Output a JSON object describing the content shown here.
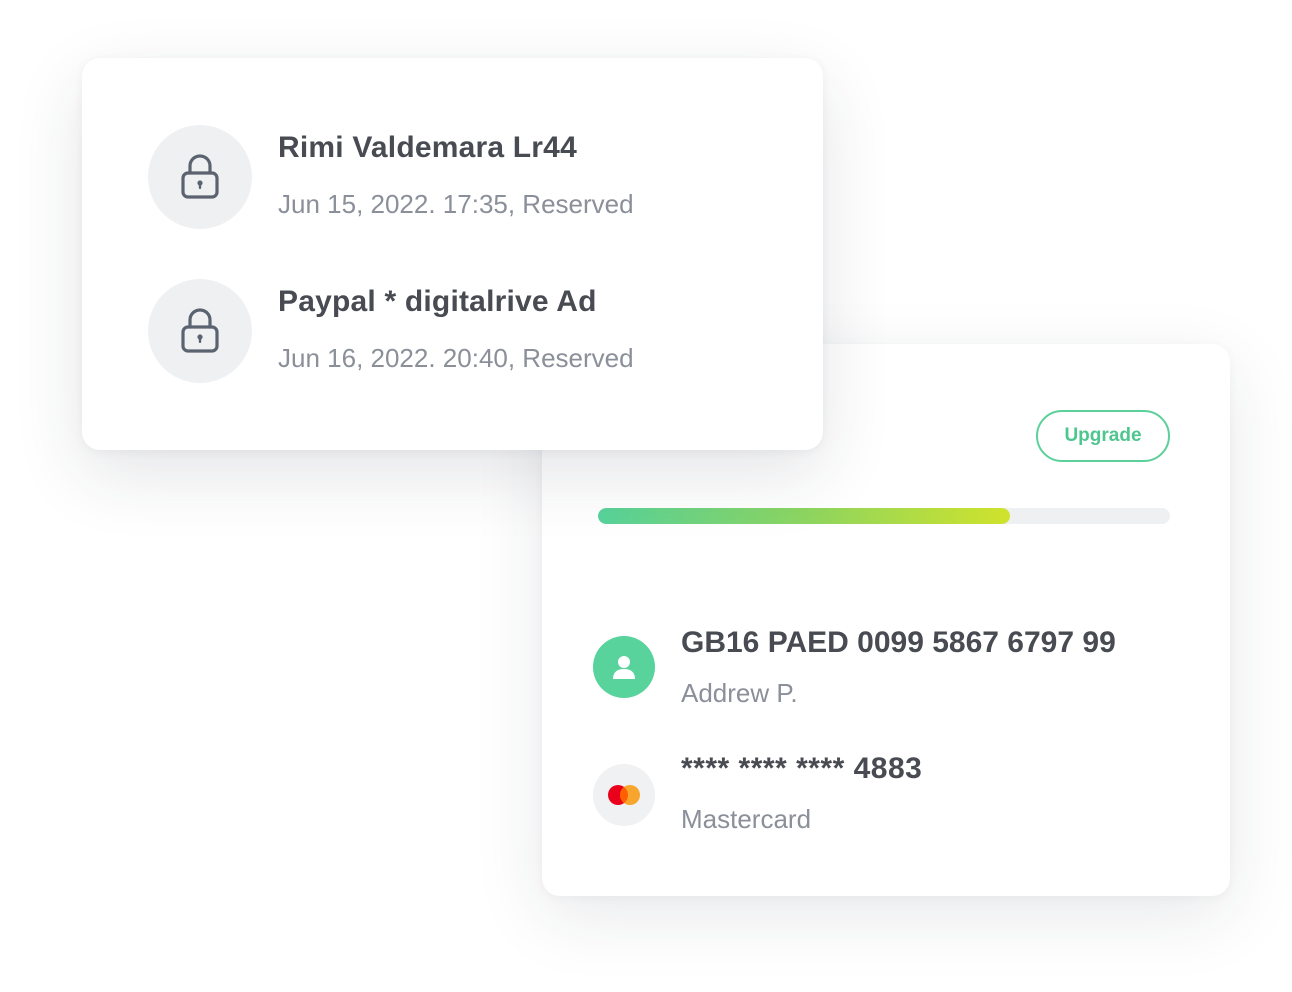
{
  "transactions": [
    {
      "merchant": "Rimi Valdemara Lr44",
      "details": "Jun 15, 2022. 17:35, Reserved",
      "icon": "lock-icon"
    },
    {
      "merchant": "Paypal * digitalrive Ad",
      "details": "Jun 16, 2022. 20:40, Reserved",
      "icon": "lock-icon"
    }
  ],
  "account": {
    "upgrade_label": "Upgrade",
    "progress_percent": 72,
    "iban": "GB16 PAED 0099 5867 6797 99",
    "holder": "Addrew P.",
    "card_number": "**** **** **** 4883",
    "card_brand": "Mastercard"
  },
  "colors": {
    "accent_green": "#57d39b",
    "progress_end": "#d0e22c",
    "mastercard_red": "#eb001b",
    "mastercard_orange": "#f79e1b",
    "text_primary": "#484b52",
    "text_secondary": "#8a8f99"
  }
}
